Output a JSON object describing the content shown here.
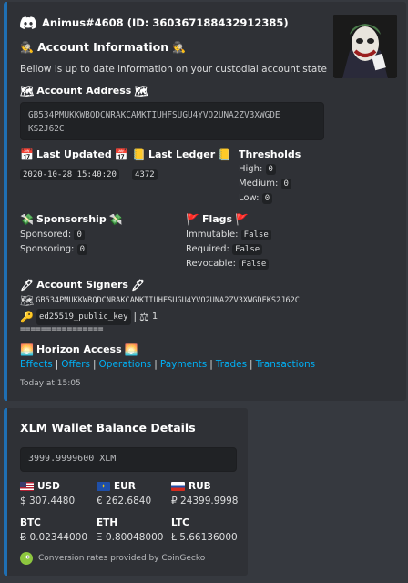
{
  "account_embed": {
    "author": "Animus#4608 (ID: 360367188432912385)",
    "title": "Account Information",
    "description": "Bellow is up to date information on your custodial account state",
    "address_title": "Account Address",
    "address_line1": "GB534PMUKKWBQDCNRAKCAMKTIUHFSUGU4YVO2UNA2ZV3XWGDE",
    "address_line2": "KS2J62C",
    "last_updated": {
      "title": "Last Updated",
      "value": "2020-10-28 15:40:20"
    },
    "last_ledger": {
      "title": "Last Ledger",
      "value": "4372"
    },
    "thresholds": {
      "title": "Thresholds",
      "rows": [
        {
          "label": "High:",
          "value": "0"
        },
        {
          "label": "Medium:",
          "value": "0"
        },
        {
          "label": "Low:",
          "value": "0"
        }
      ]
    },
    "sponsorship": {
      "title": "Sponsorship",
      "rows": [
        {
          "label": "Sponsored:",
          "value": "0"
        },
        {
          "label": "Sponsoring:",
          "value": "0"
        }
      ]
    },
    "flags": {
      "title": "Flags",
      "rows": [
        {
          "label": "Immutable:",
          "value": "False"
        },
        {
          "label": "Required:",
          "value": "False"
        },
        {
          "label": "Revocable:",
          "value": "False"
        }
      ]
    },
    "signers": {
      "title": "Account Signers",
      "signer_key": "GB534PMUKKWBQDCNRAKCAMKTIUHFSUGU4YVO2UNA2ZV3XWGDEKS2J62C",
      "key_type": "ed25519_public_key",
      "weight": "1",
      "divider": "================"
    },
    "horizon": {
      "title": "Horizon Access",
      "links": [
        "Effects",
        "Offers",
        "Operations",
        "Payments",
        "Trades",
        "Transactions"
      ]
    },
    "footer": "Today at 15:05"
  },
  "balance_embed": {
    "title": "XLM Wallet Balance Details",
    "balance": "3999.9999600 XLM",
    "fiat": [
      {
        "code": "USD",
        "value": "$ 307.4480",
        "flag": "us-flag-icon"
      },
      {
        "code": "EUR",
        "value": "€ 262.6840",
        "flag": "eu-flag-icon"
      },
      {
        "code": "RUB",
        "value": "₽ 24399.9998",
        "flag": "ru-flag-icon"
      }
    ],
    "crypto": [
      {
        "code": "BTC",
        "value": "Ƀ 0.02344000"
      },
      {
        "code": "ETH",
        "value": "Ξ 0.80048000"
      },
      {
        "code": "LTC",
        "value": "Ł 5.66136000"
      }
    ],
    "footer": "Conversion rates provided by CoinGecko"
  },
  "colors": {
    "background": "#36393f",
    "embed": "#2f3136",
    "accent": "#1f6fb3",
    "link": "#00aff4"
  }
}
